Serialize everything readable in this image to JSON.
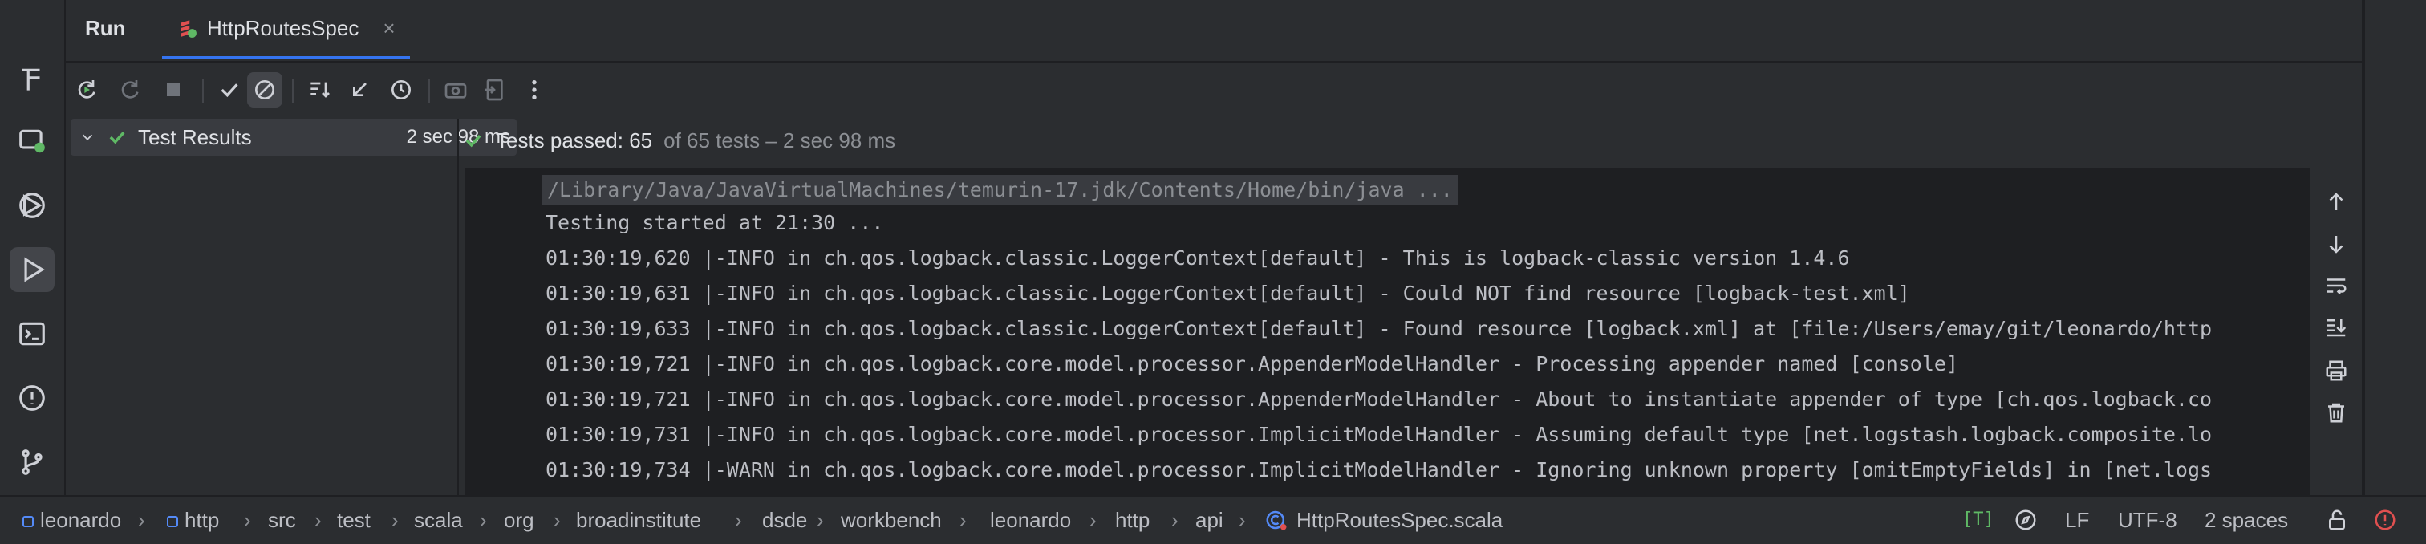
{
  "run_panel": {
    "title": "Run",
    "tab_label": "HttpRoutesSpec",
    "tab_close": "×"
  },
  "toolbar": {
    "icons": [
      "rerun-icon",
      "rerun-failed-icon",
      "stop-icon",
      "show-passed-icon",
      "show-ignored-icon",
      "sort-icon",
      "collapse-icon",
      "history-icon",
      "screenshot-icon",
      "export-icon",
      "more-icon"
    ]
  },
  "tree": {
    "root_label": "Test Results",
    "root_time": "2 sec 98 ms"
  },
  "status": {
    "main": "Tests passed: 65",
    "rest": "of 65 tests – 2 sec 98 ms"
  },
  "console": {
    "lines": [
      "/Library/Java/JavaVirtualMachines/temurin-17.jdk/Contents/Home/bin/java ...",
      "Testing started at 21:30 ...",
      "01:30:19,620 |-INFO in ch.qos.logback.classic.LoggerContext[default] - This is logback-classic version 1.4.6",
      "01:30:19,631 |-INFO in ch.qos.logback.classic.LoggerContext[default] - Could NOT find resource [logback-test.xml]",
      "01:30:19,633 |-INFO in ch.qos.logback.classic.LoggerContext[default] - Found resource [logback.xml] at [file:/Users/emay/git/leonardo/http",
      "01:30:19,721 |-INFO in ch.qos.logback.core.model.processor.AppenderModelHandler - Processing appender named [console]",
      "01:30:19,721 |-INFO in ch.qos.logback.core.model.processor.AppenderModelHandler - About to instantiate appender of type [ch.qos.logback.co",
      "01:30:19,731 |-INFO in ch.qos.logback.core.model.processor.ImplicitModelHandler - Assuming default type [net.logstash.logback.composite.lo",
      "01:30:19,734 |-WARN in ch.qos.logback.core.model.processor.ImplicitModelHandler - Ignoring unknown property [omitEmptyFields] in [net.logs"
    ]
  },
  "breadcrumb": [
    "leonardo",
    "http",
    "src",
    "test",
    "scala",
    "org",
    "broadinstitute",
    "dsde",
    "workbench",
    "leonardo",
    "http",
    "api",
    "HttpRoutesSpec.scala"
  ],
  "statusbar": {
    "badge": "[T]",
    "line_sep": "LF",
    "encoding": "UTF-8",
    "indent": "2 spaces"
  },
  "colors": {
    "accent": "#3574f0",
    "success": "#5fb865",
    "background": "#2b2d30",
    "console_bg": "#1e1f22"
  }
}
